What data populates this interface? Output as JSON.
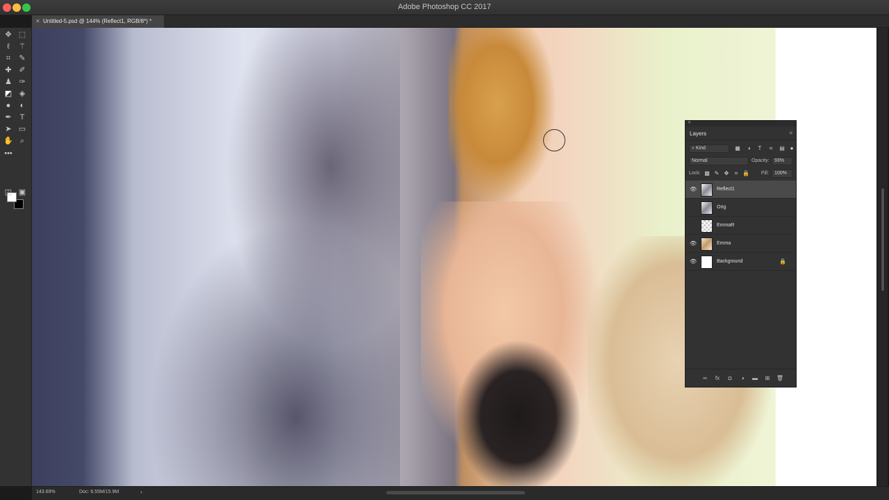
{
  "app": {
    "title": "Adobe Photoshop CC 2017"
  },
  "document": {
    "tab_title": "Untitled-5.psd @ 144% (Reflect1, RGB/8*) *"
  },
  "status": {
    "zoom": "143.69%",
    "doc_info": "Doc: 6.55M/15.9M",
    "arrow": "›"
  },
  "layers_panel": {
    "title": "Layers",
    "filter_kind": "Kind",
    "blend_mode": "Normal",
    "opacity_label": "Opacity:",
    "opacity_value": "93%",
    "lock_label": "Lock:",
    "fill_label": "Fill:",
    "fill_value": "100%",
    "layers": [
      {
        "name": "Reflect1",
        "visible": true,
        "selected": true
      },
      {
        "name": "Orig",
        "visible": false,
        "selected": false
      },
      {
        "name": "EmmaR",
        "visible": false,
        "selected": false
      },
      {
        "name": "Emma",
        "visible": true,
        "selected": false
      },
      {
        "name": "Background",
        "visible": true,
        "selected": false,
        "locked": true
      }
    ]
  },
  "icons": {
    "eye": "👁",
    "lock": "🔒",
    "search": "⌕",
    "menu": "≡",
    "chevron": "⌄"
  },
  "toolbar": {
    "tools": [
      "move-tool",
      "marquee-tool",
      "lasso-tool",
      "magic-wand-tool",
      "crop-tool",
      "eyedropper-tool",
      "healing-brush-tool",
      "brush-tool",
      "clone-stamp-tool",
      "history-brush-tool",
      "eraser-tool",
      "paint-bucket-tool",
      "blur-tool",
      "dodge-tool",
      "pen-tool",
      "type-tool",
      "path-selection-tool",
      "rectangle-tool",
      "hand-tool",
      "zoom-tool",
      "more-tools",
      "quick-mask",
      "screen-mode"
    ]
  }
}
